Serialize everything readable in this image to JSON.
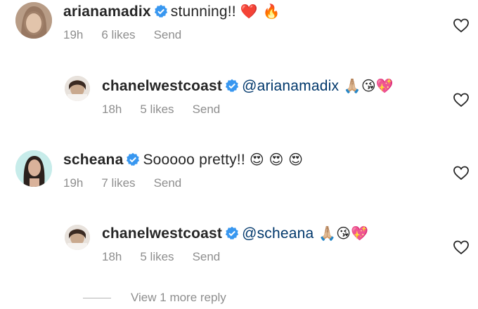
{
  "comments": [
    {
      "username": "arianamadix",
      "text": "stunning!! ",
      "emoji": "❤️ 🔥",
      "time": "19h",
      "likes": "6 likes",
      "send": "Send"
    },
    {
      "username": "chanelwestcoast",
      "mention": "@arianamadix",
      "emoji": " 🙏🏼😘💖",
      "time": "18h",
      "likes": "5 likes",
      "send": "Send"
    },
    {
      "username": "scheana",
      "text": "Sooooo pretty!! ",
      "emoji": "😍 😍 😍",
      "time": "19h",
      "likes": "7 likes",
      "send": "Send"
    },
    {
      "username": "chanelwestcoast",
      "mention": "@scheana",
      "emoji": " 🙏🏼😘💖",
      "time": "18h",
      "likes": "5 likes",
      "send": "Send"
    }
  ],
  "view_more": "View 1 more reply",
  "colors": {
    "text": "#262626",
    "secondary": "#8e8e8e",
    "mention": "#00376b",
    "verified": "#3897f0"
  }
}
